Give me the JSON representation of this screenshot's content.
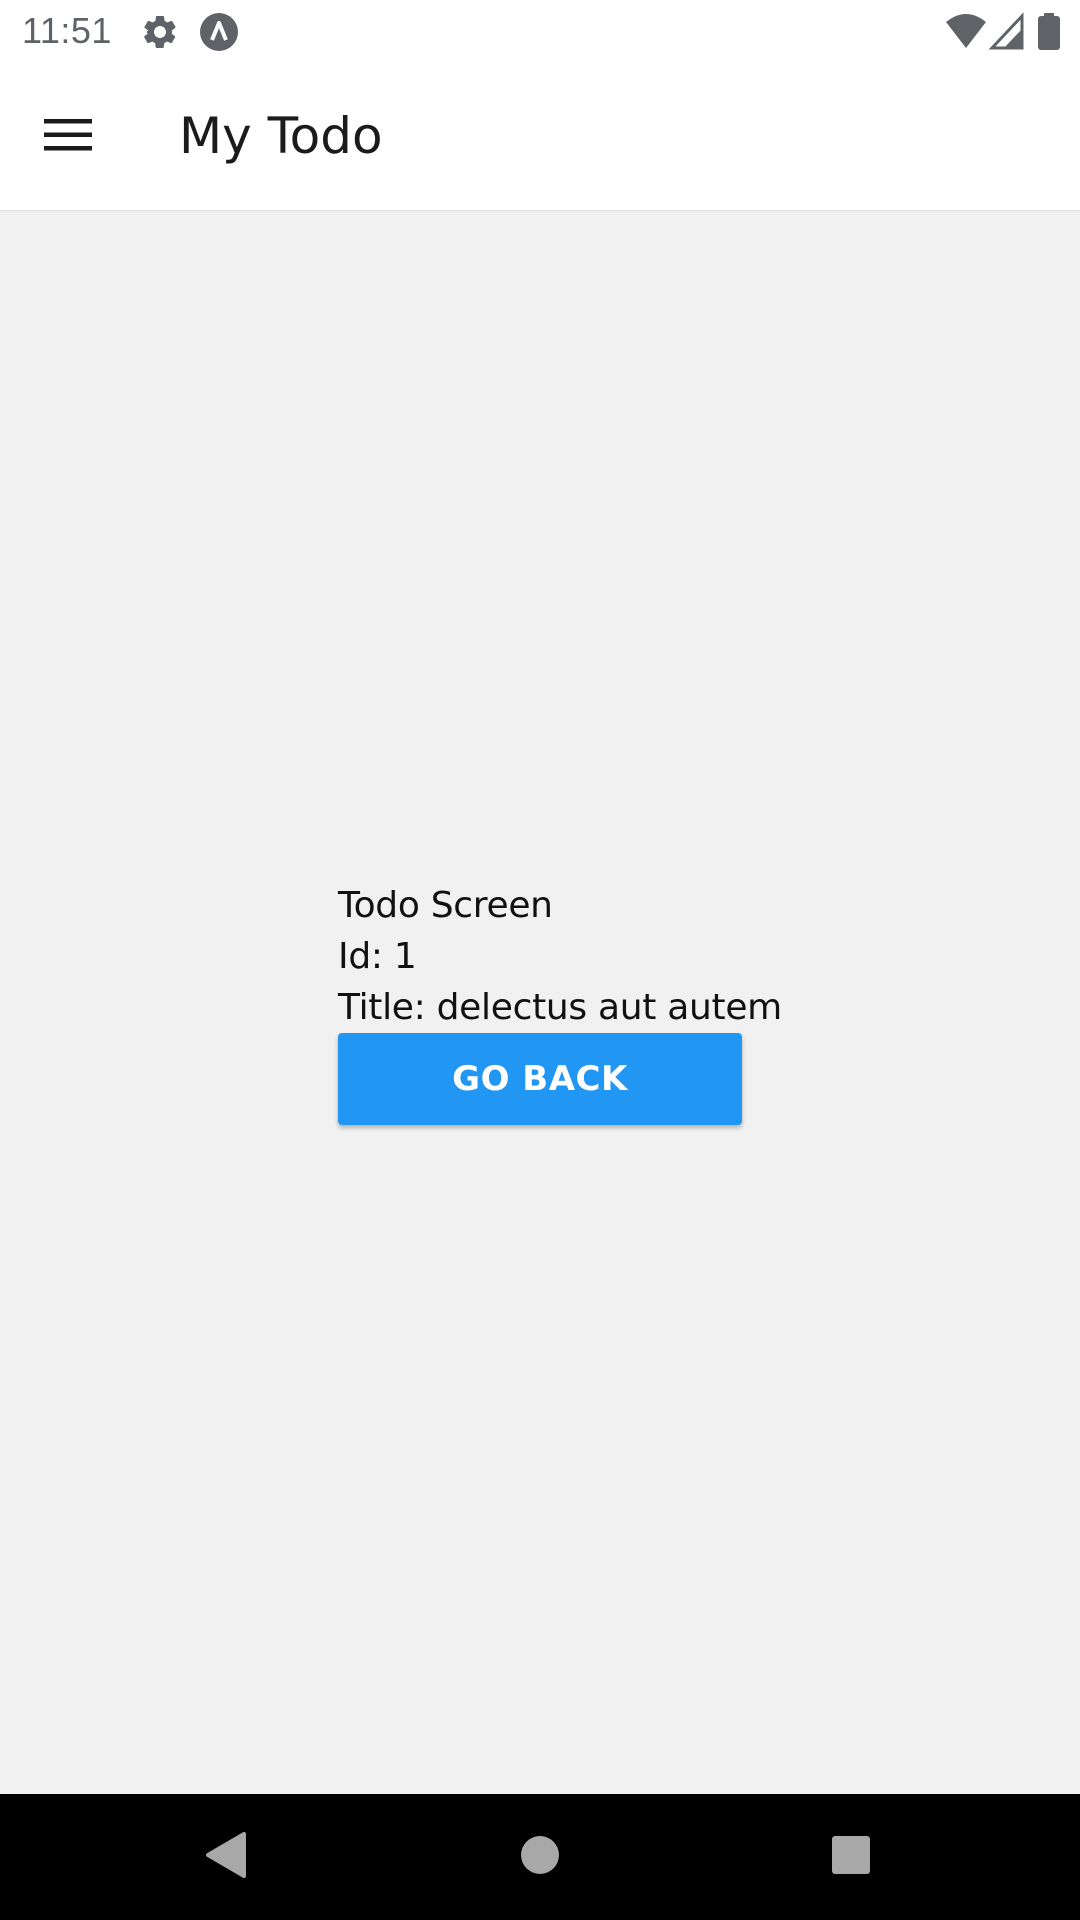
{
  "status_bar": {
    "time": "11:51",
    "icons": [
      "settings-icon",
      "app-notification-icon",
      "wifi-icon",
      "cell-signal-icon",
      "battery-icon"
    ],
    "icon_color": "#5f6368"
  },
  "app_bar": {
    "title": "My Todo",
    "menu_icon": "hamburger-menu-icon"
  },
  "content": {
    "heading": "Todo Screen",
    "id_line": "Id: 1",
    "title_line": "Title: delectus aut autem",
    "button_label": "GO BACK",
    "button_color": "#2196f3"
  },
  "nav_bar": {
    "buttons": [
      "back-icon",
      "home-icon",
      "recents-icon"
    ]
  },
  "colors": {
    "background": "#f1f1f1",
    "app_bar": "#ffffff",
    "nav_bar": "#000000"
  }
}
